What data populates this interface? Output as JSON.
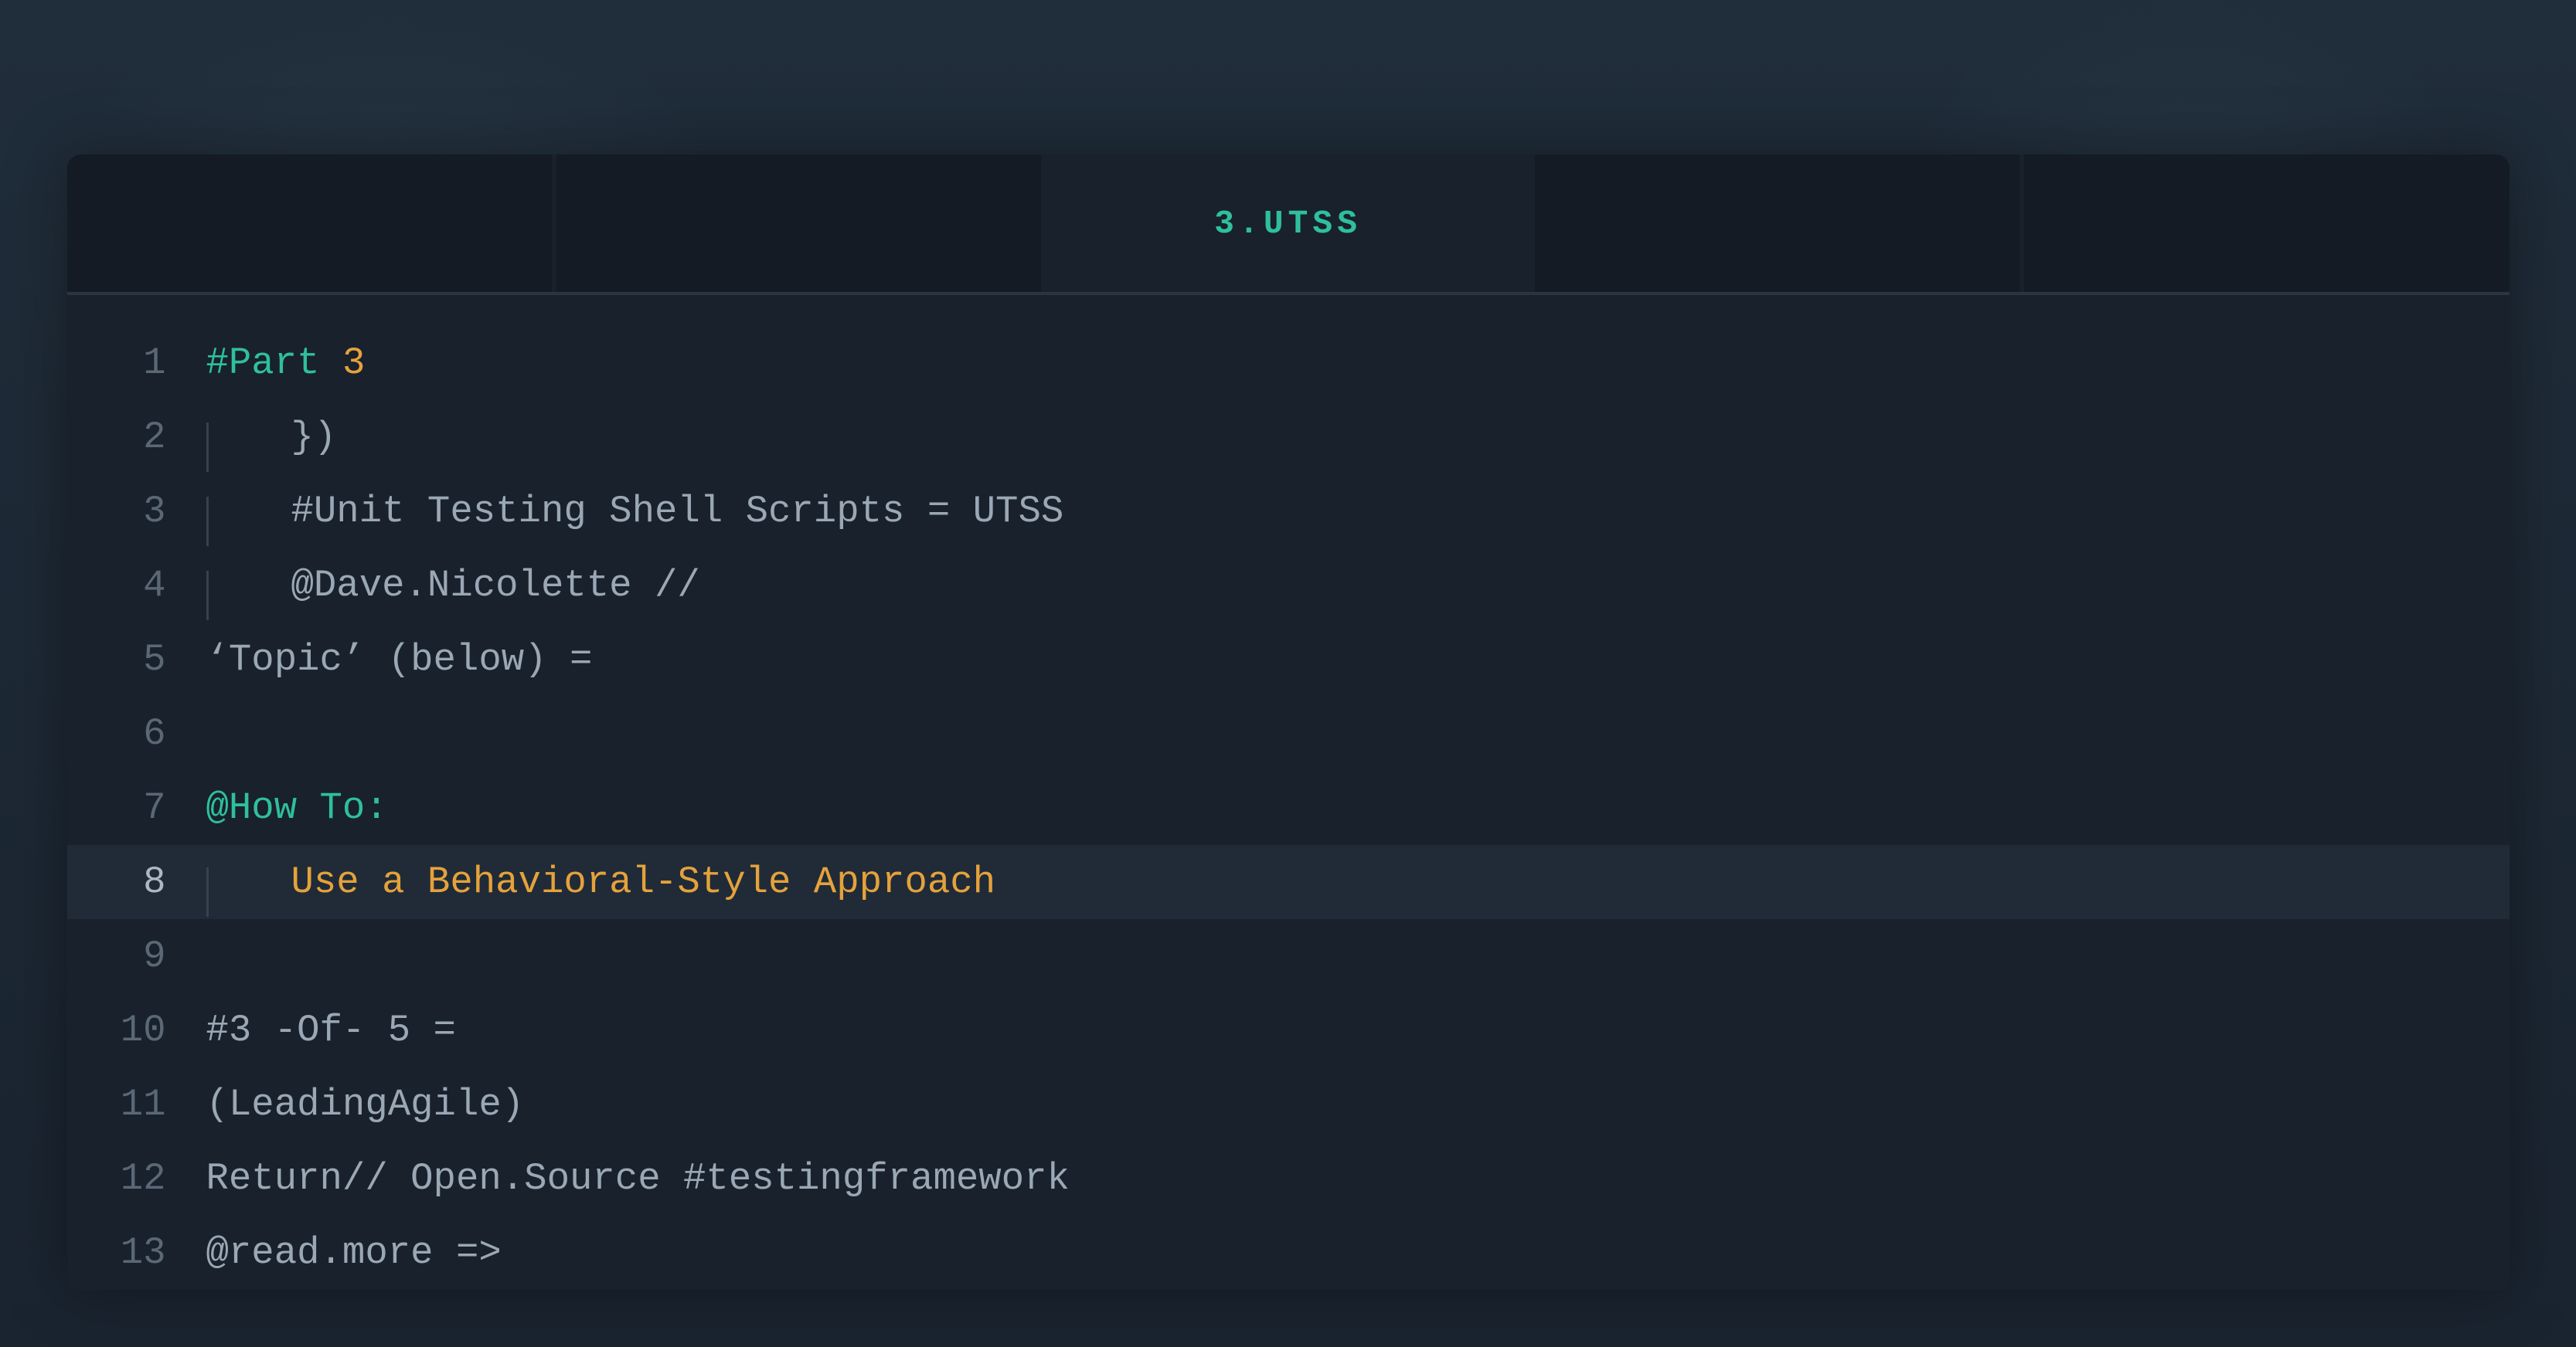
{
  "tabs": {
    "items": [
      {
        "label": ""
      },
      {
        "label": ""
      },
      {
        "label": "3.UTSS",
        "active": true
      },
      {
        "label": ""
      },
      {
        "label": ""
      }
    ]
  },
  "gutter": {
    "l1": "1",
    "l2": "2",
    "l3": "3",
    "l4": "4",
    "l5": "5",
    "l6": "6",
    "l7": "7",
    "l8": "8",
    "l9": "9",
    "l10": "10",
    "l11": "11",
    "l12": "12",
    "l13": "13"
  },
  "code": {
    "l1a": "#Part ",
    "l1b": "3",
    "l2": "})",
    "l3": "#Unit Testing Shell Scripts = UTSS",
    "l4": "@Dave.Nicolette //",
    "l5": "‘Topic’ (below) =",
    "l6": "",
    "l7": "@How To:",
    "l8": "Use a Behavioral-Style Approach",
    "l9": "",
    "l10": "#3 -Of- 5 =",
    "l11": "(LeadingAgile)",
    "l12": "Return// Open.Source #testingframework",
    "l13": "@read.more =>"
  },
  "colors": {
    "bg": "#18212c",
    "tab_inactive": "#141b24",
    "accent_teal": "#2fbf9e",
    "accent_amber": "#e5a23b",
    "text_muted": "#9aa7b4",
    "gutter": "#5a6876",
    "highlight_row": "#202b37"
  },
  "highlighted_line": 8
}
